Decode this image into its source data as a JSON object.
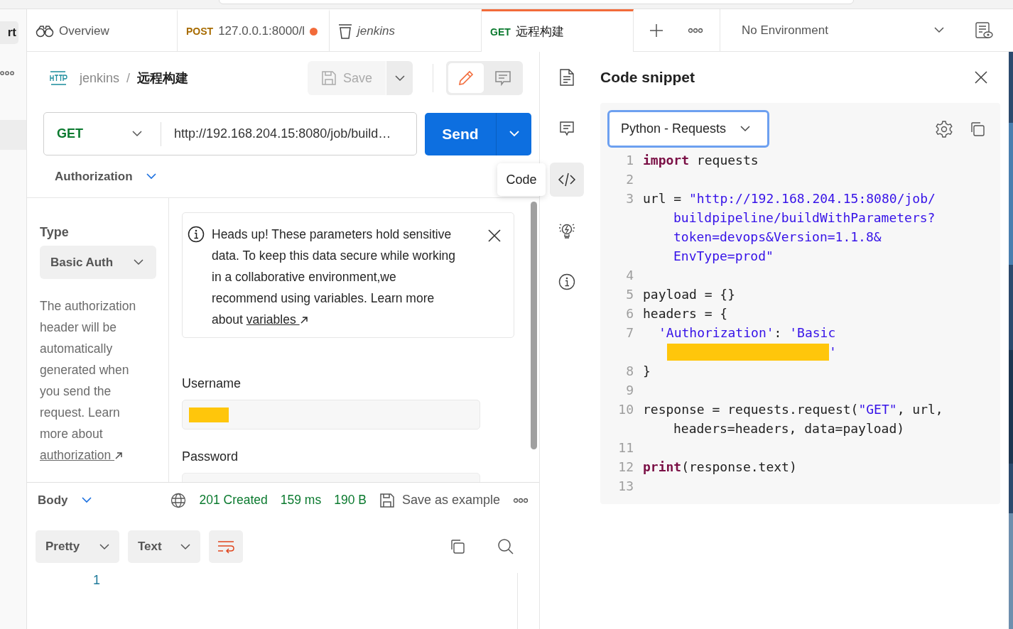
{
  "sidebar": {
    "button": "rt",
    "items": [
      {
        "selected": true
      }
    ]
  },
  "tabs": [
    {
      "kind": "overview",
      "label": "Overview",
      "selected": false
    },
    {
      "kind": "request",
      "method": "POST",
      "label": "127.0.0.1:8000/l",
      "unsaved": true,
      "selected": false
    },
    {
      "kind": "collection",
      "label": "jenkins",
      "selected": false
    },
    {
      "kind": "request",
      "method": "GET",
      "label": "远程构建",
      "unsaved": false,
      "selected": true
    }
  ],
  "environment": "No Environment",
  "breadcrumb": {
    "collection": "jenkins",
    "separator": "/",
    "request": "远程构建"
  },
  "save": "Save",
  "mode_toggle": [
    {
      "kind": "edit",
      "selected": true
    },
    {
      "kind": "comment",
      "selected": false
    }
  ],
  "request": {
    "method": "GET",
    "url": "http://192.168.204.15:8080/job/build…",
    "send": "Send"
  },
  "section": "Authorization",
  "tooltip": "Code",
  "auth": {
    "type_label": "Type",
    "type_value": "Basic Auth",
    "description": "The authorization header will be automatically generated when you send the request. Learn more about",
    "link": "authorization"
  },
  "alert": {
    "text": "Heads up! These parameters hold sensitive data. To keep this data secure while working in a collaborative environment,we recommend using variables. Learn more about",
    "link": "variables"
  },
  "fields": [
    {
      "label": "Username",
      "redacted": true
    },
    {
      "label": "Password",
      "redacted": false
    }
  ],
  "response": {
    "section": "Body",
    "status": "201 Created",
    "time": "159 ms",
    "size": "190 B",
    "save": "Save as example",
    "format": "Pretty",
    "type": "Text",
    "line_numbers": [
      "1"
    ]
  },
  "rail": [
    {
      "kind": "docs",
      "selected": false
    },
    {
      "kind": "comments",
      "selected": false
    },
    {
      "kind": "code",
      "selected": true
    },
    {
      "kind": "insights",
      "selected": false
    },
    {
      "kind": "info",
      "selected": false
    }
  ],
  "snippet": {
    "title": "Code snippet",
    "language": "Python - Requests",
    "lines": [
      {
        "number": "1",
        "rows": [
          {
            "tokens": [
              {
                "kind": "keyword",
                "text": "import"
              },
              {
                "kind": "plain",
                "text": " requests"
              }
            ]
          }
        ]
      },
      {
        "number": "2",
        "rows": [
          {
            "tokens": []
          }
        ]
      },
      {
        "number": "3",
        "rows": [
          {
            "tokens": [
              {
                "kind": "plain",
                "text": "url = "
              },
              {
                "kind": "string",
                "text": "\"http://192.168.204.15:8080/job/"
              }
            ]
          },
          {
            "tokens": [
              {
                "kind": "string",
                "text": "buildpipeline/buildWithParameters?"
              }
            ]
          },
          {
            "tokens": [
              {
                "kind": "string",
                "text": "token=devops&Version=1.1.8&"
              }
            ]
          },
          {
            "tokens": [
              {
                "kind": "string",
                "text": "EnvType=prod\""
              }
            ]
          }
        ]
      },
      {
        "number": "4",
        "rows": [
          {
            "tokens": []
          }
        ]
      },
      {
        "number": "5",
        "rows": [
          {
            "tokens": [
              {
                "kind": "plain",
                "text": "payload = {}"
              }
            ]
          }
        ]
      },
      {
        "number": "6",
        "rows": [
          {
            "tokens": [
              {
                "kind": "plain",
                "text": "headers = {"
              }
            ]
          }
        ]
      },
      {
        "number": "7",
        "rows": [
          {
            "kind": "nested",
            "tokens": [
              {
                "kind": "string",
                "text": "'Authorization'"
              },
              {
                "kind": "plain",
                "text": ": "
              },
              {
                "kind": "string",
                "text": "'Basic"
              }
            ]
          },
          {
            "tokens": [
              {
                "kind": "redacted"
              },
              {
                "kind": "string",
                "text": "'"
              }
            ]
          }
        ]
      },
      {
        "number": "8",
        "rows": [
          {
            "tokens": [
              {
                "kind": "plain",
                "text": "}"
              }
            ]
          }
        ]
      },
      {
        "number": "9",
        "rows": [
          {
            "tokens": []
          }
        ]
      },
      {
        "number": "10",
        "rows": [
          {
            "tokens": [
              {
                "kind": "plain",
                "text": "response = requests.request("
              },
              {
                "kind": "string",
                "text": "\"GET\""
              },
              {
                "kind": "plain",
                "text": ", url,"
              }
            ]
          },
          {
            "tokens": [
              {
                "kind": "plain",
                "text": "headers=headers, data=payload)"
              }
            ]
          }
        ]
      },
      {
        "number": "11",
        "rows": [
          {
            "tokens": []
          }
        ]
      },
      {
        "number": "12",
        "rows": [
          {
            "tokens": [
              {
                "kind": "keyword",
                "text": "print"
              },
              {
                "kind": "plain",
                "text": "(response.text)"
              }
            ]
          }
        ]
      },
      {
        "number": "13",
        "rows": [
          {
            "tokens": []
          }
        ]
      }
    ]
  }
}
